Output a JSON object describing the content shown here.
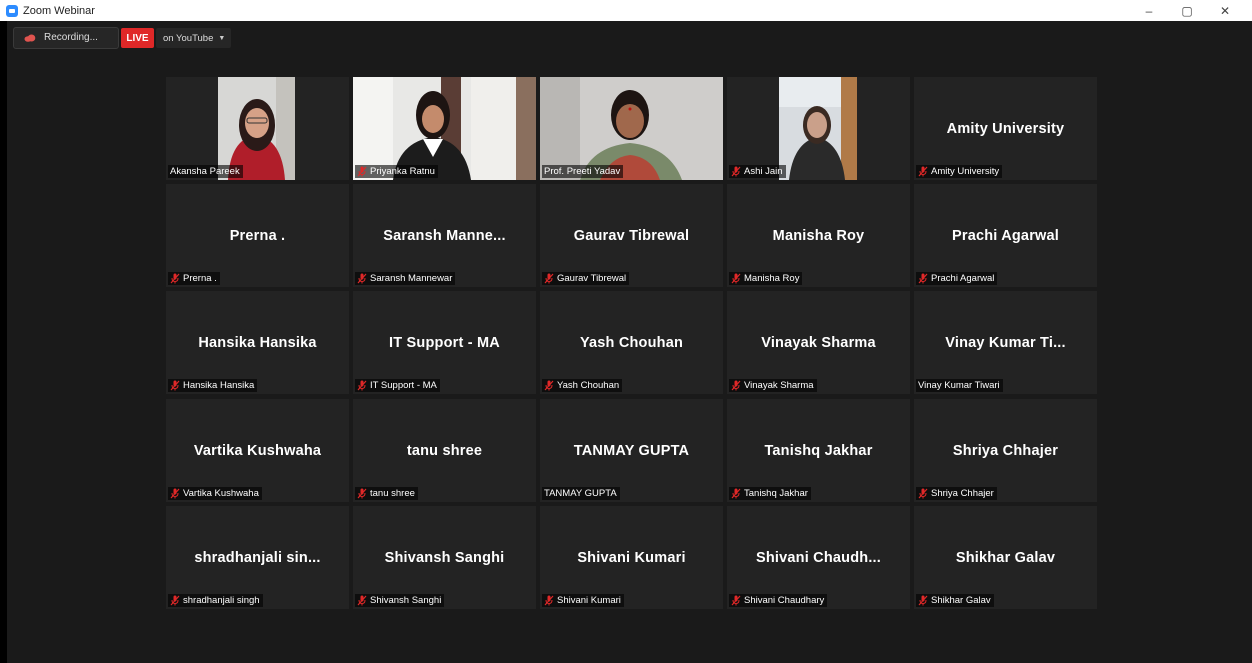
{
  "window": {
    "title": "Zoom Webinar",
    "minimize": "–",
    "restore": "▢",
    "close": "✕"
  },
  "toolbar": {
    "recording_label": "Recording...",
    "live_label": "LIVE",
    "stream_label": "on YouTube"
  },
  "colors": {
    "live_red": "#E02828",
    "active_speaker": "#BFF274",
    "muted_mic": "#E02828",
    "tile_bg": "#232323"
  },
  "participants": [
    {
      "name": "Akansha Pareek",
      "display": "",
      "video": true,
      "muted": false
    },
    {
      "name": "Priyanka Ratnu",
      "display": "",
      "video": true,
      "muted": true
    },
    {
      "name": "Prof. Preeti Yadav",
      "display": "",
      "video": true,
      "muted": false,
      "active": true
    },
    {
      "name": "Ashi Jain",
      "display": "",
      "video": true,
      "muted": true
    },
    {
      "name": "Amity University",
      "display": "Amity University",
      "video": false,
      "muted": true
    },
    {
      "name": "Prerna .",
      "display": "Prerna .",
      "video": false,
      "muted": true
    },
    {
      "name": "Saransh Mannewar",
      "display": "Saransh  Manne...",
      "video": false,
      "muted": true
    },
    {
      "name": "Gaurav Tibrewal",
      "display": "Gaurav Tibrewal",
      "video": false,
      "muted": true
    },
    {
      "name": "Manisha Roy",
      "display": "Manisha Roy",
      "video": false,
      "muted": true
    },
    {
      "name": "Prachi Agarwal",
      "display": "Prachi Agarwal",
      "video": false,
      "muted": true
    },
    {
      "name": "Hansika Hansika",
      "display": "Hansika Hansika",
      "video": false,
      "muted": true
    },
    {
      "name": "IT Support - MA",
      "display": "IT Support - MA",
      "video": false,
      "muted": true
    },
    {
      "name": "Yash Chouhan",
      "display": "Yash Chouhan",
      "video": false,
      "muted": true
    },
    {
      "name": "Vinayak Sharma",
      "display": "Vinayak Sharma",
      "video": false,
      "muted": true
    },
    {
      "name": "Vinay Kumar Tiwari",
      "display": "Vinay  Kumar  Ti...",
      "video": false,
      "muted": false
    },
    {
      "name": "Vartika Kushwaha",
      "display": "Vartika Kushwaha",
      "video": false,
      "muted": true
    },
    {
      "name": "tanu shree",
      "display": "tanu shree",
      "video": false,
      "muted": true
    },
    {
      "name": "TANMAY GUPTA",
      "display": "TANMAY GUPTA",
      "video": false,
      "muted": false
    },
    {
      "name": "Tanishq Jakhar",
      "display": "Tanishq Jakhar",
      "video": false,
      "muted": true
    },
    {
      "name": "Shriya Chhajer",
      "display": "Shriya Chhajer",
      "video": false,
      "muted": true
    },
    {
      "name": "shradhanjali singh",
      "display": "shradhanjali  sin...",
      "video": false,
      "muted": true
    },
    {
      "name": "Shivansh Sanghi",
      "display": "Shivansh Sanghi",
      "video": false,
      "muted": true
    },
    {
      "name": "Shivani Kumari",
      "display": "Shivani Kumari",
      "video": false,
      "muted": true
    },
    {
      "name": "Shivani Chaudhary",
      "display": "Shivani  Chaudh...",
      "video": false,
      "muted": true
    },
    {
      "name": "Shikhar Galav",
      "display": "Shikhar Galav",
      "video": false,
      "muted": true
    }
  ]
}
